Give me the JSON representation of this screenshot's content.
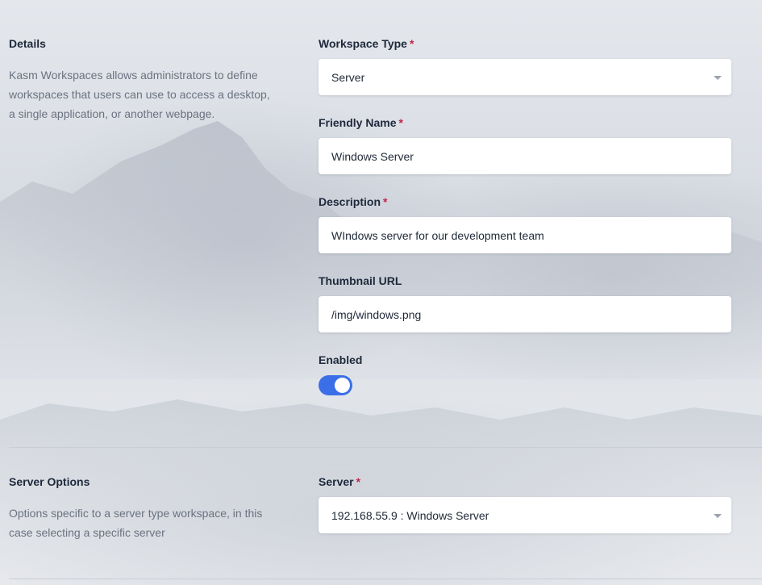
{
  "details": {
    "title": "Details",
    "description": "Kasm Workspaces allows administrators to define workspaces that users can use to access a desktop, a single application, or another webpage."
  },
  "fields": {
    "workspace_type": {
      "label": "Workspace Type",
      "required": "*",
      "value": "Server"
    },
    "friendly_name": {
      "label": "Friendly Name",
      "required": "*",
      "value": "Windows Server"
    },
    "description": {
      "label": "Description",
      "required": "*",
      "value": "WIndows server for our development team"
    },
    "thumbnail_url": {
      "label": "Thumbnail URL",
      "value": "/img/windows.png"
    },
    "enabled": {
      "label": "Enabled",
      "state": "on"
    }
  },
  "server_options": {
    "title": "Server Options",
    "description": "Options specific to a server type workspace, in this case selecting a specific server",
    "server": {
      "label": "Server",
      "required": "*",
      "value": "192.168.55.9 : Windows Server"
    }
  },
  "colors": {
    "accent": "#3b6fe8",
    "required": "#c0264b"
  },
  "icons": {
    "select_caret": "caret-down-icon"
  }
}
